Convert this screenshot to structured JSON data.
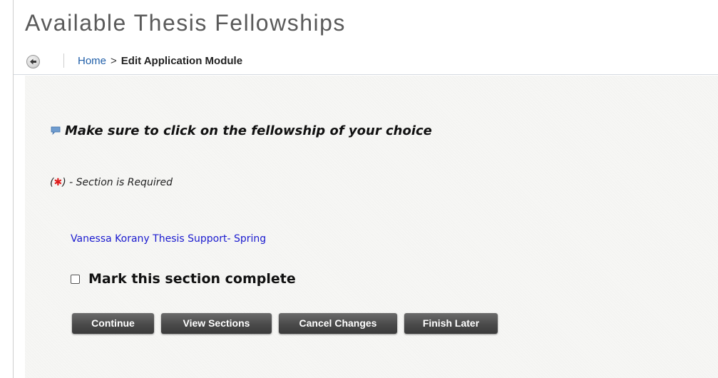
{
  "page": {
    "title": "Available Thesis Fellowships"
  },
  "breadcrumb": {
    "back_icon": "back-arrow-icon",
    "home_label": "Home",
    "separator": ">",
    "current_label": "Edit Application Module"
  },
  "notice": {
    "icon": "speech-bubble-icon",
    "text": "Make sure to click on the fellowship of your choice"
  },
  "required_note": {
    "open": "(",
    "asterisk": "✱",
    "close_text": ") - Section is Required"
  },
  "fellowship": {
    "link_label": "Vanessa Korany Thesis Support- Spring"
  },
  "complete": {
    "label": "Mark this section complete",
    "checked": false
  },
  "actions": {
    "continue_label": "Continue",
    "view_sections_label": "View Sections",
    "cancel_changes_label": "Cancel Changes",
    "finish_later_label": "Finish Later"
  },
  "colors": {
    "link": "#1a1acf",
    "breadcrumb_link": "#1f5ea8",
    "required_asterisk": "#e01b1b",
    "button_bg": "#4a4a4a",
    "content_bg": "#f6f6f4"
  }
}
